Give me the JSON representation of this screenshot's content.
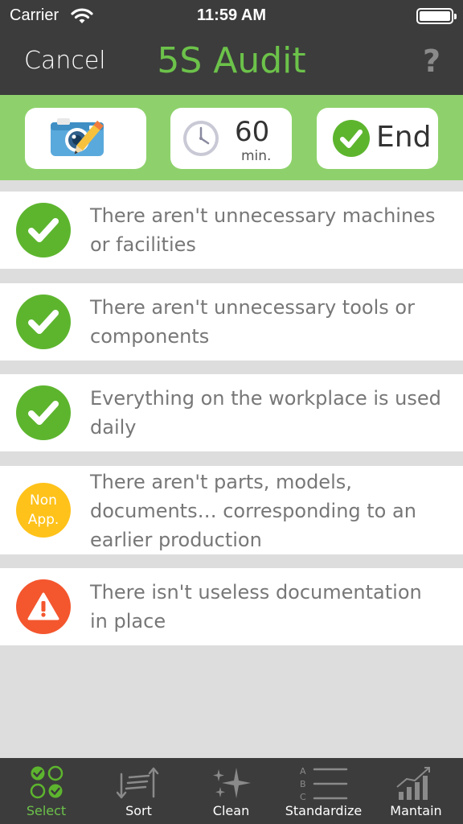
{
  "status_bar": {
    "carrier": "Carrier",
    "time": "11:59 AM"
  },
  "nav": {
    "cancel_label": "Cancel",
    "title": "5S Audit",
    "help_label": "?"
  },
  "toolbar": {
    "timer_value": "60",
    "timer_unit": "min.",
    "end_label": "End"
  },
  "checklist": [
    {
      "status": "ok",
      "text": "There aren't unnecessary machines or facilities"
    },
    {
      "status": "ok",
      "text": "There aren't unnecessary tools or components"
    },
    {
      "status": "ok",
      "text": "Everything on the workplace is used daily"
    },
    {
      "status": "na",
      "status_label": "Non App.",
      "text": "There aren't parts, models, documents… corresponding to an earlier production"
    },
    {
      "status": "warning",
      "text": "There isn't useless documentation in place"
    }
  ],
  "tabs": [
    {
      "label": "Select",
      "icon": "select-grid-icon",
      "active": true
    },
    {
      "label": "Sort",
      "icon": "sort-icon",
      "active": false
    },
    {
      "label": "Clean",
      "icon": "sparkle-icon",
      "active": false
    },
    {
      "label": "Standardize",
      "icon": "abc-list-icon",
      "active": false
    },
    {
      "label": "Mantain",
      "icon": "growth-chart-icon",
      "active": false
    }
  ],
  "colors": {
    "bar_dark": "#3c3c3c",
    "accent_green": "#6cc24a",
    "toolbar_green": "#8ed16c",
    "ok": "#5db52e",
    "not_applicable": "#ffc21a",
    "warning": "#f4562e"
  }
}
